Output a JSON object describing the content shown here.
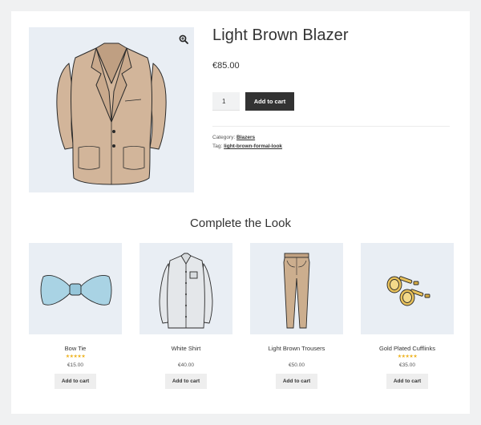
{
  "product": {
    "title": "Light Brown Blazer",
    "price": "€85.00",
    "quantity": "1",
    "add_to_cart_label": "Add to cart",
    "category_label": "Category:",
    "category_value": "Blazers",
    "tag_label": "Tag:",
    "tag_value": "light-brown-formal-look"
  },
  "icons": {
    "zoom": "magnifier-zoom-icon"
  },
  "related": {
    "title": "Complete the Look",
    "items": [
      {
        "name": "Bow Tie",
        "stars": "★★★★★",
        "rating": 5,
        "price": "€15.00",
        "button": "Add to cart"
      },
      {
        "name": "White Shirt",
        "stars": "",
        "price": "€40.00",
        "button": "Add to cart"
      },
      {
        "name": "Light Brown Trousers",
        "stars": "",
        "price": "€50.00",
        "button": "Add to cart"
      },
      {
        "name": "Gold Plated Cufflinks",
        "stars": "★★★★★",
        "rating": 5,
        "price": "€35.00",
        "button": "Add to cart"
      }
    ]
  },
  "colors": {
    "accent_dark": "#333333",
    "star": "#eeb21f",
    "image_bg": "#e9eef4",
    "page_bg": "#f0f1f2"
  }
}
